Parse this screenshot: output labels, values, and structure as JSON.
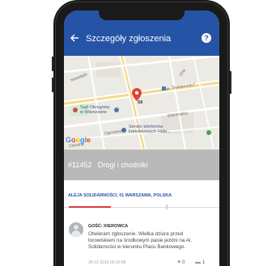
{
  "header": {
    "title": "Szczegóły zgłoszenia",
    "back_icon": "arrow-left-icon",
    "help_glyph": "?"
  },
  "map": {
    "labels": {
      "court": "Sąd Okręgowy\nw Warszawie",
      "street": "aleja \"Solidarności\"",
      "service": "Serwis telefonów\nkomórkowych Hala...",
      "nowolipki": "Nowolipki",
      "elektoralna": "Elektoralna",
      "orla": "Orla",
      "ogrodowa": "Ogrodowa",
      "chlodna": "Chłodna",
      "route": "S8"
    },
    "google": [
      "G",
      "o",
      "o",
      "g",
      "l",
      "e"
    ],
    "pin_color": "#e0413a"
  },
  "report": {
    "id": "#11452",
    "category": "Drogi i chodniki"
  },
  "address": "ALEJA SOLIDARNOŚCI, 01 WARSZAWA, POLSKA",
  "comment": {
    "author": "GOŚĆ: KIEROWCA",
    "text": "Otwieram zgłoszenie. Wielka dziura przed torowiskiem na środkowym pasie jezdni na Al. Solidarności w kierunku Placu Bankowego.",
    "date": "28-01-2019 09:20:08",
    "likes": "0",
    "comments": "1"
  },
  "colors": {
    "primary": "#2553a6",
    "accent": "#e03a3a",
    "band": "#b9b9b9"
  }
}
